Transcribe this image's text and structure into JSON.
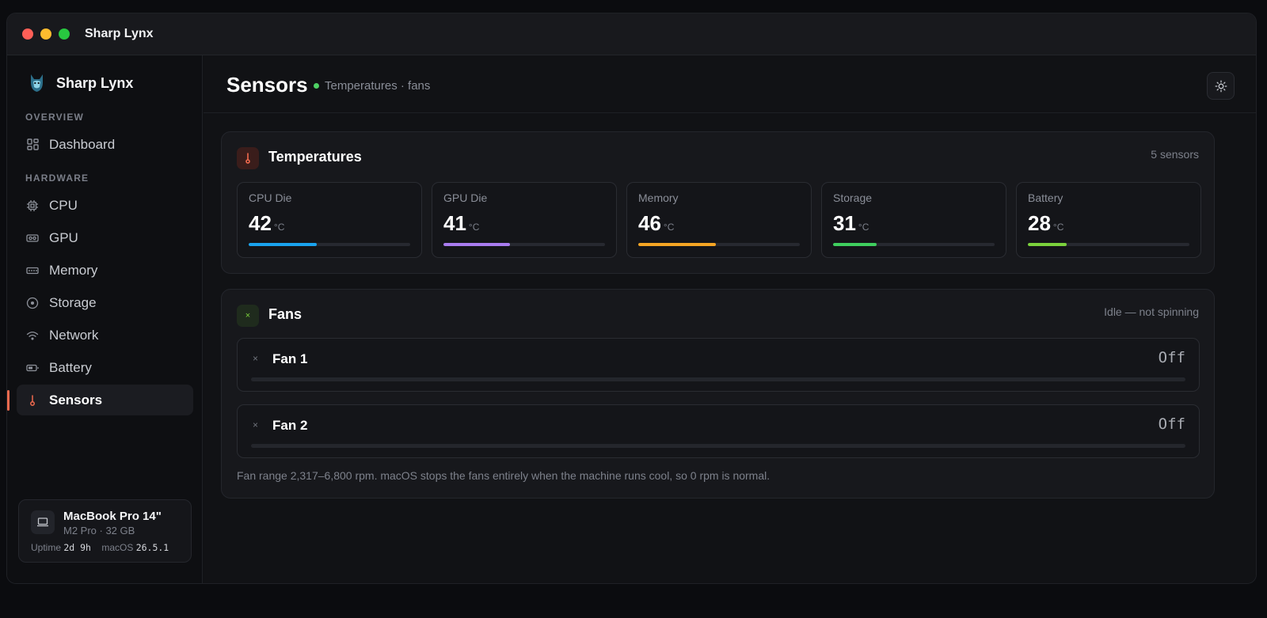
{
  "window": {
    "title": "Sharp Lynx"
  },
  "sidebar": {
    "brand": "Sharp Lynx",
    "sections": {
      "overview": "OVERVIEW",
      "hardware": "HARDWARE"
    },
    "items": [
      {
        "label": "Dashboard",
        "icon": "grid-icon"
      },
      {
        "label": "CPU",
        "icon": "chip-icon"
      },
      {
        "label": "GPU",
        "icon": "gpu-card-icon"
      },
      {
        "label": "Memory",
        "icon": "memory-stick-icon"
      },
      {
        "label": "Storage",
        "icon": "disk-icon"
      },
      {
        "label": "Network",
        "icon": "wifi-icon"
      },
      {
        "label": "Battery",
        "icon": "battery-icon"
      },
      {
        "label": "Sensors",
        "icon": "thermometer-icon",
        "active": true
      }
    ],
    "device": {
      "name": "MacBook Pro 14\"",
      "spec": "M2 Pro · 32 GB",
      "uptime_label": "Uptime",
      "uptime_value": "2d 9h",
      "os_label": "macOS",
      "os_value": "26.5.1"
    }
  },
  "header": {
    "title": "Sensors",
    "status": "Temperatures · fans",
    "status_color": "#4ed164"
  },
  "temperatures": {
    "title": "Temperatures",
    "meta": "5 sensors",
    "unit": "°C",
    "sensors": [
      {
        "label": "CPU Die",
        "value": "42",
        "level": 0.42,
        "color": "#1aa3ef"
      },
      {
        "label": "GPU Die",
        "value": "41",
        "level": 0.41,
        "color": "#a97cf0"
      },
      {
        "label": "Memory",
        "value": "46",
        "level": 0.48,
        "color": "#f5a524"
      },
      {
        "label": "Storage",
        "value": "31",
        "level": 0.27,
        "color": "#3fcf5e"
      },
      {
        "label": "Battery",
        "value": "28",
        "level": 0.24,
        "color": "#7bd23c"
      }
    ]
  },
  "fans": {
    "title": "Fans",
    "meta": "Idle — not spinning",
    "items": [
      {
        "name": "Fan 1",
        "state": "Off",
        "level": 0
      },
      {
        "name": "Fan 2",
        "state": "Off",
        "level": 0
      }
    ],
    "note": "Fan range 2,317–6,800 rpm. macOS stops the fans entirely when the machine runs cool, so 0 rpm is normal."
  },
  "colors": {
    "accent": "#f06a4e",
    "sensor_icon": "#f06a4e",
    "fan_icon": "#7bd23c"
  }
}
